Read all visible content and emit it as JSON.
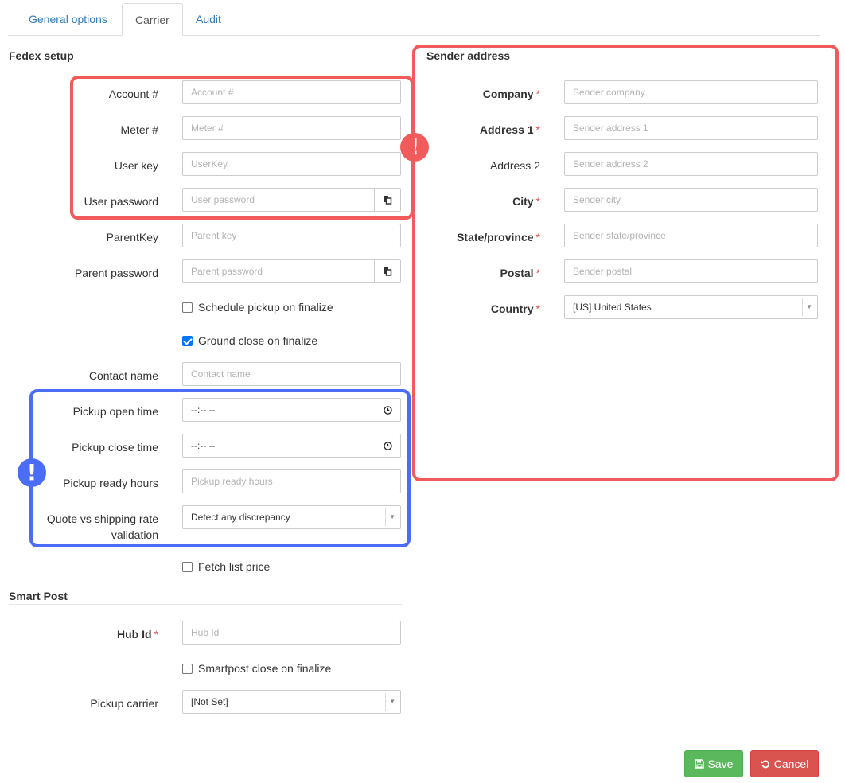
{
  "tabs": [
    "General options",
    "Carrier",
    "Audit"
  ],
  "fedex": {
    "title": "Fedex setup",
    "account_label": "Account #",
    "account_placeholder": "Account #",
    "meter_label": "Meter #",
    "meter_placeholder": "Meter #",
    "userkey_label": "User key",
    "userkey_placeholder": "UserKey",
    "userpass_label": "User password",
    "userpass_placeholder": "User password",
    "parentkey_label": "ParentKey",
    "parentkey_placeholder": "Parent key",
    "parentpass_label": "Parent password",
    "parentpass_placeholder": "Parent password",
    "schedule_pickup_label": "Schedule pickup on finalize",
    "schedule_pickup_checked": false,
    "ground_close_label": "Ground close on finalize",
    "ground_close_checked": true,
    "contact_label": "Contact name",
    "contact_placeholder": "Contact name",
    "pickup_open_label": "Pickup open time",
    "pickup_open_value": "--:-- --",
    "pickup_close_label": "Pickup close time",
    "pickup_close_value": "--:-- --",
    "ready_hours_label": "Pickup ready hours",
    "ready_hours_placeholder": "Pickup ready hours",
    "quote_label_1": "Quote vs shipping rate",
    "quote_label_2": "validation",
    "quote_value": "Detect any discrepancy",
    "fetch_list_label": "Fetch list price",
    "fetch_list_checked": false
  },
  "smartpost": {
    "title": "Smart Post",
    "hub_label": "Hub Id",
    "hub_placeholder": "Hub Id",
    "close_label": "Smartpost close on finalize",
    "close_checked": false,
    "pickup_carrier_label": "Pickup carrier",
    "pickup_carrier_value": "[Not Set]"
  },
  "sender": {
    "title": "Sender address",
    "company_label": "Company",
    "company_placeholder": "Sender company",
    "address1_label": "Address 1",
    "address1_placeholder": "Sender address 1",
    "address2_label": "Address 2",
    "address2_placeholder": "Sender address 2",
    "city_label": "City",
    "city_placeholder": "Sender city",
    "state_label": "State/province",
    "state_placeholder": "Sender state/province",
    "postal_label": "Postal",
    "postal_placeholder": "Sender postal",
    "country_label": "Country",
    "country_value": "[US] United States",
    "required_mark": "*"
  },
  "annotations": {
    "alert_symbol": "!",
    "red": "#f15b5b",
    "blue": "#4a6cf7"
  },
  "buttons": {
    "save": "Save",
    "cancel": "Cancel"
  },
  "icons": {
    "copy": "copy-icon",
    "clock": "clock-icon",
    "caret": "caret-down-icon",
    "save": "floppy-disk-icon",
    "cancel": "undo-icon"
  }
}
